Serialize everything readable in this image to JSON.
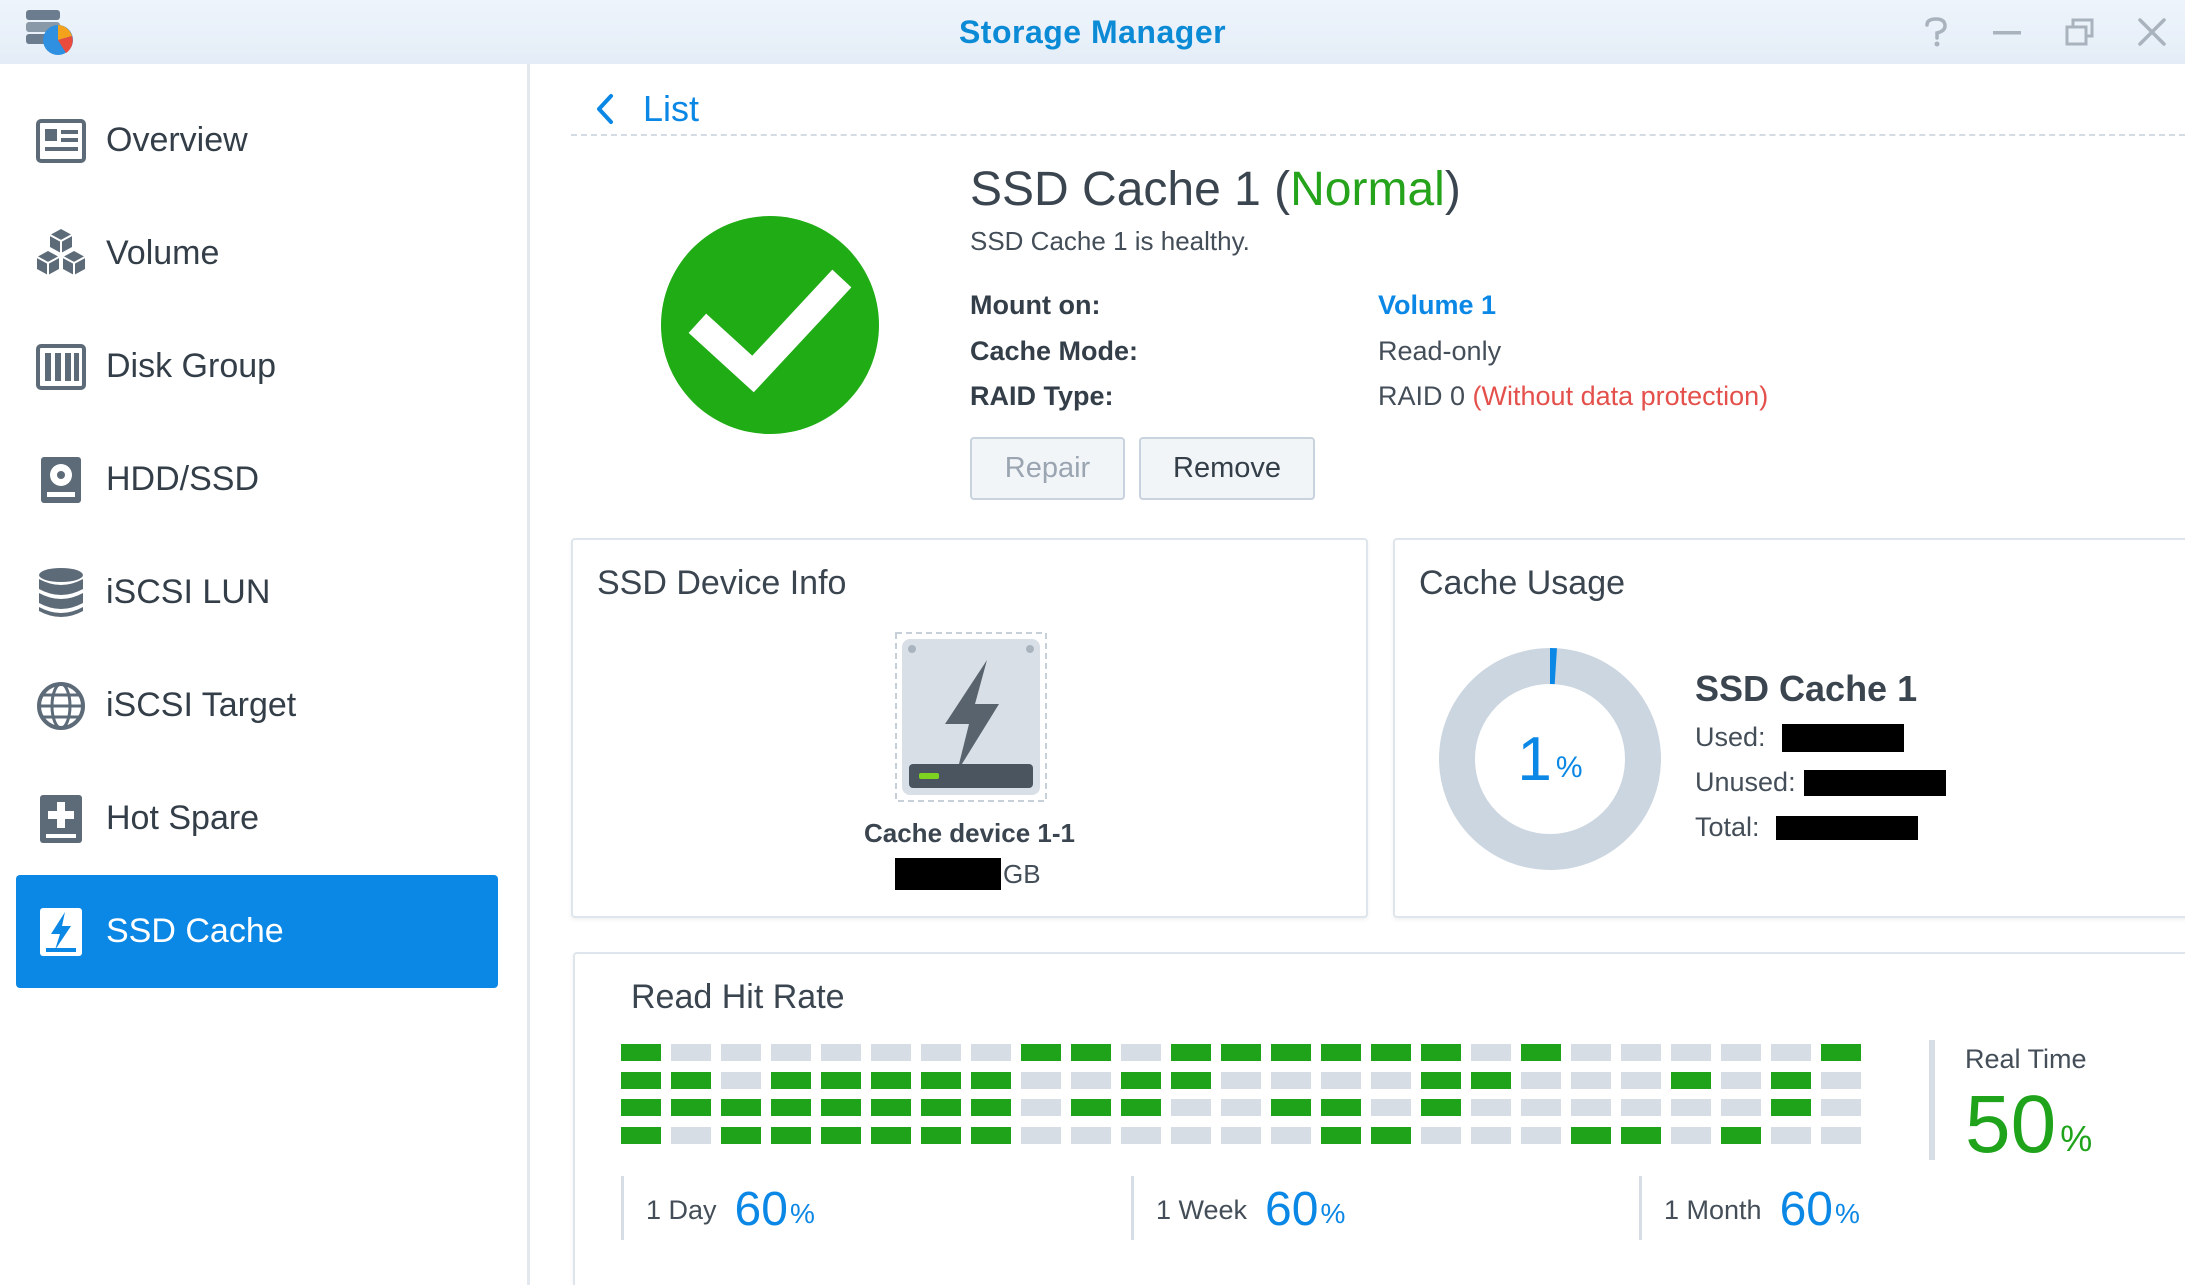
{
  "window": {
    "title": "Storage Manager"
  },
  "sidebar": {
    "items": [
      {
        "label": "Overview",
        "icon": "overview-icon",
        "active": false
      },
      {
        "label": "Volume",
        "icon": "volume-icon",
        "active": false
      },
      {
        "label": "Disk Group",
        "icon": "disk-group-icon",
        "active": false
      },
      {
        "label": "HDD/SSD",
        "icon": "hdd-icon",
        "active": false
      },
      {
        "label": "iSCSI LUN",
        "icon": "iscsi-lun-icon",
        "active": false
      },
      {
        "label": "iSCSI Target",
        "icon": "globe-icon",
        "active": false
      },
      {
        "label": "Hot Spare",
        "icon": "hot-spare-icon",
        "active": false
      },
      {
        "label": "SSD Cache",
        "icon": "ssd-cache-icon",
        "active": true
      }
    ]
  },
  "header": {
    "back_label": "List"
  },
  "cache": {
    "name": "SSD Cache 1",
    "open_paren": " (",
    "status": "Normal",
    "close_paren": ")",
    "subtitle": "SSD Cache 1 is healthy.",
    "mount_on_label": "Mount on:",
    "mount_on_value": "Volume 1",
    "cache_mode_label": "Cache Mode:",
    "cache_mode_value": "Read-only",
    "raid_type_label": "RAID Type:",
    "raid_type_value": "RAID 0",
    "raid_type_warning": "(Without data protection)",
    "status_color": "#24a31b",
    "warning_color": "#e4504b"
  },
  "buttons": {
    "repair": "Repair",
    "remove": "Remove"
  },
  "device_info": {
    "title": "SSD Device Info",
    "device_name": "Cache device 1-1",
    "size_unit": "GB"
  },
  "cache_usage": {
    "title": "Cache Usage",
    "percent": 1,
    "percent_text": "1",
    "percent_sign": "%",
    "name": "SSD Cache 1",
    "used_label": "Used:",
    "unused_label": "Unused:",
    "total_label": "Total:"
  },
  "read_hit_rate": {
    "title": "Read Hit Rate",
    "realtime_label": "Real Time",
    "realtime_value": "50",
    "percent_sign": "%",
    "periods": [
      {
        "label": "1 Day",
        "value": "60"
      },
      {
        "label": "1 Week",
        "value": "60"
      },
      {
        "label": "1 Month",
        "value": "60"
      }
    ],
    "history_rows": [
      "1000000011011111101000001",
      "1101111100110000110001010",
      "1111111101100110100000010",
      "1011111100000011000110100"
    ]
  },
  "colors": {
    "accent": "#0b87e5",
    "good": "#1fa31b",
    "inactive": "#d6dde4"
  }
}
